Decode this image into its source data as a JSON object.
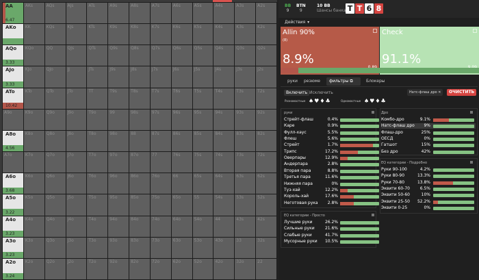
{
  "matrix": {
    "labels": [
      "AA",
      "AKs",
      "AQs",
      "AJs",
      "ATs",
      "A9s",
      "A8s",
      "A7s",
      "A6s",
      "A5s",
      "A4s",
      "A3s",
      "A2s",
      "AKo",
      "KK",
      "KQs",
      "KJs",
      "KTs",
      "K9s",
      "K8s",
      "K7s",
      "K6s",
      "K5s",
      "K4s",
      "K3s",
      "K2s",
      "AQo",
      "KQo",
      "QQ",
      "QJs",
      "QTs",
      "Q9s",
      "Q8s",
      "Q7s",
      "Q6s",
      "Q5s",
      "Q4s",
      "Q3s",
      "Q2s",
      "AJo",
      "KJo",
      "QJo",
      "JJ",
      "JTs",
      "J9s",
      "J8s",
      "J7s",
      "J6s",
      "J5s",
      "J4s",
      "J3s",
      "J2s",
      "ATo",
      "KTo",
      "QTo",
      "JTo",
      "TT",
      "T9s",
      "T8s",
      "T7s",
      "T6s",
      "T5s",
      "T4s",
      "T3s",
      "T2s",
      "A9o",
      "K9o",
      "Q9o",
      "J9o",
      "T9o",
      "99",
      "98s",
      "97s",
      "96s",
      "95s",
      "94s",
      "93s",
      "92s",
      "A8o",
      "K8o",
      "Q8o",
      "J8o",
      "T8o",
      "98o",
      "88",
      "87s",
      "86s",
      "85s",
      "84s",
      "83s",
      "82s",
      "A7o",
      "K7o",
      "Q7o",
      "J7o",
      "T7o",
      "97o",
      "87o",
      "77",
      "76s",
      "75s",
      "74s",
      "73s",
      "72s",
      "A6o",
      "K6o",
      "Q6o",
      "J6o",
      "T6o",
      "96o",
      "86o",
      "76o",
      "66",
      "65s",
      "64s",
      "63s",
      "62s",
      "A5o",
      "K5o",
      "Q5o",
      "J5o",
      "T5o",
      "95o",
      "85o",
      "75o",
      "65o",
      "55",
      "54s",
      "53s",
      "52s",
      "A4o",
      "K4o",
      "Q4o",
      "J4o",
      "T4o",
      "94o",
      "84o",
      "74o",
      "64o",
      "54o",
      "44",
      "43s",
      "42s",
      "A3o",
      "K3o",
      "Q3o",
      "J3o",
      "T3o",
      "93o",
      "83o",
      "73o",
      "63o",
      "53o",
      "43o",
      "33",
      "32s",
      "A2o",
      "K2o",
      "Q2o",
      "J2o",
      "T2o",
      "92o",
      "82o",
      "72o",
      "62o",
      "52o",
      "42o",
      "32o",
      "22"
    ],
    "active": {
      "AA": {
        "combos": "6.47",
        "allin": 0.15
      },
      "AKo": {
        "combos": "",
        "allin": 0
      },
      "AQo": {
        "combos": "3.33",
        "allin": 0
      },
      "AJo": {
        "combos": "3.33",
        "allin": 0
      },
      "ATo": {
        "combos": "10.42",
        "allin": 1
      },
      "A8o": {
        "combos": "4.56",
        "allin": 0
      },
      "A6o": {
        "combos": "3.68",
        "allin": 0
      },
      "A5o": {
        "combos": "3.22",
        "allin": 0
      },
      "A4o": {
        "combos": "3.23",
        "allin": 0
      },
      "A3o": {
        "combos": "3.23",
        "allin": 0
      },
      "A2o": {
        "combos": "3.24",
        "allin": 0
      }
    }
  },
  "header": {
    "pos1": {
      "top": "BB",
      "bottom": "9"
    },
    "pos2": {
      "top": "BTN",
      "bottom": "9"
    },
    "stack_title": "10 BB",
    "stack_sub": "Шансы банка",
    "logo": [
      "T",
      "T",
      "6",
      "8"
    ]
  },
  "actions_label": "Действия",
  "cards": {
    "allin": {
      "name": "Allin 90%",
      "sub": "(8)",
      "pct": "8.9%",
      "combos": "0.89",
      "combos_label": "combos",
      "frac": 0.089
    },
    "check": {
      "name": "Check",
      "pct": "91.1%",
      "combos": "9.09",
      "combos_label": "combos"
    }
  },
  "tabs": [
    "руки",
    "резюме",
    "фильтры",
    "Блокеры"
  ],
  "filters": {
    "enable": "Включить",
    "exclude": "Исключить",
    "chip": "Натс-флаш дро",
    "chip_close": "✕",
    "clear": "ОЧИСТИТЬ",
    "diff_suits": "Разномастные",
    "same_suits": "Одномастные",
    "diff_suit_icons": "♠♥♦♣",
    "same_suit_icons": "♠♥♦♣"
  },
  "hands_section": {
    "title": "руки",
    "rows": [
      {
        "name": "Стрейт-флаш",
        "value": "0.4%",
        "frac": 1,
        "red": 0
      },
      {
        "name": "Каре",
        "value": "0.9%",
        "frac": 1,
        "red": 0
      },
      {
        "name": "Фулл-хаус",
        "value": "5.5%",
        "frac": 1,
        "red": 0
      },
      {
        "name": "Флеш",
        "value": "5.6%",
        "frac": 1,
        "red": 0
      },
      {
        "name": "Стрейт",
        "value": "1.7%",
        "frac": 1,
        "red": 0.85
      },
      {
        "name": "Трипс",
        "value": "17.2%",
        "frac": 1,
        "red": 0.45
      },
      {
        "name": "Оверпары",
        "value": "12.9%",
        "frac": 1,
        "red": 0.2
      },
      {
        "name": "Андерпара",
        "value": "2.8%",
        "frac": 1,
        "red": 0
      },
      {
        "name": "Вторая пара",
        "value": "8.8%",
        "frac": 1,
        "red": 0
      },
      {
        "name": "Третья пара",
        "value": "11.6%",
        "frac": 1,
        "red": 0
      },
      {
        "name": "Нижняя пара",
        "value": "0%",
        "frac": 1,
        "red": 0
      },
      {
        "name": "Туз-хай",
        "value": "12.2%",
        "frac": 1,
        "red": 0.2
      },
      {
        "name": "Король-хай",
        "value": "17.6%",
        "frac": 1,
        "red": 0.35
      },
      {
        "name": "Неготовая рука",
        "value": "2.8%",
        "frac": 1,
        "red": 0.35
      }
    ]
  },
  "draw_section": {
    "title": "Дро",
    "rows": [
      {
        "name": "Комбо-дро",
        "value": "9.1%",
        "frac": 1,
        "red": 0.38
      },
      {
        "name": "Натс-флаш дро",
        "value": "9%",
        "frac": 1,
        "red": 0,
        "hl": true
      },
      {
        "name": "Флаш-дро",
        "value": "25%",
        "frac": 1,
        "red": 0
      },
      {
        "name": "ОЕСД",
        "value": "0%",
        "frac": 1,
        "red": 0
      },
      {
        "name": "Гатшот",
        "value": "15%",
        "frac": 1,
        "red": 0
      },
      {
        "name": "Без дро",
        "value": "42%",
        "frac": 1,
        "red": 0
      }
    ]
  },
  "eq_detail": {
    "title": "EQ категории - Подробно",
    "rows": [
      {
        "name": "Руки 90-100",
        "value": "4.2%",
        "frac": 1,
        "red": 0
      },
      {
        "name": "Руки 80-90",
        "value": "13.3%",
        "frac": 1,
        "red": 0
      },
      {
        "name": "Руки 70-80",
        "value": "13.8%",
        "frac": 1,
        "red": 0.48
      },
      {
        "name": "Эквити 60-70",
        "value": "6.5%",
        "frac": 1,
        "red": 0
      },
      {
        "name": "Эквити 50-60",
        "value": "10%",
        "frac": 1,
        "red": 0
      },
      {
        "name": "Эквити 25-50",
        "value": "52.2%",
        "frac": 1,
        "red": 0.12
      },
      {
        "name": "Эквити 0-25",
        "value": "0%",
        "frac": 1,
        "red": 0
      }
    ]
  },
  "eq_simple": {
    "title": "EQ категории - Просто",
    "rows": [
      {
        "name": "Лучшие руки",
        "value": "26.2%",
        "frac": 1,
        "red": 0
      },
      {
        "name": "Сильные руки",
        "value": "21.6%",
        "frac": 1,
        "red": 0
      },
      {
        "name": "Слабые руки",
        "value": "41.7%",
        "frac": 1,
        "red": 0
      },
      {
        "name": "Мусорные руки",
        "value": "10.5%",
        "frac": 1,
        "red": 0
      }
    ]
  },
  "colors": {
    "red": "#b65a48",
    "green": "#6aa86a",
    "accent": "#d64541"
  }
}
